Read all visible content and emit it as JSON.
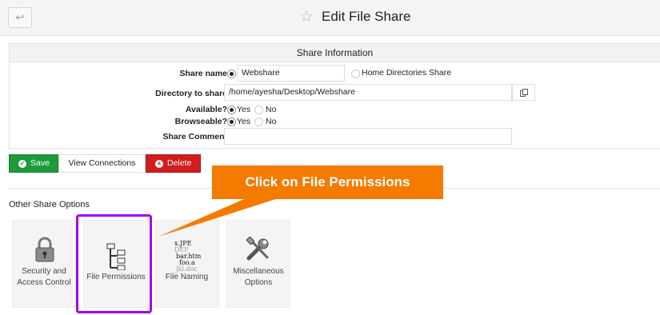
{
  "header": {
    "back_icon": "↩",
    "title": "Edit File Share"
  },
  "panel": {
    "title": "Share Information",
    "share_name_label": "Share name",
    "share_name_value": "Webshare",
    "home_dirs_label": "Home Directories Share",
    "directory_label": "Directory to share",
    "directory_value": "/home/ayesha/Desktop/Webshare",
    "available_label": "Available?",
    "browseable_label": "Browseable?",
    "yes": "Yes",
    "no": "No",
    "comment_label": "Share Comment",
    "comment_value": ""
  },
  "buttons": {
    "save": "Save",
    "view_connections": "View Connections",
    "delete": "Delete"
  },
  "other_options": {
    "title": "Other Share Options",
    "items": [
      {
        "label_line1": "Security and",
        "label_line2": "Access Control",
        "icon": "lock-icon"
      },
      {
        "label_line1": "File Permissions",
        "label_line2": "",
        "icon": "file-tree-icon"
      },
      {
        "label_line1": "File Naming",
        "label_line2": "",
        "icon": "file-naming-icon"
      },
      {
        "label_line1": "Miscellaneous",
        "label_line2": "Options",
        "icon": "tools-icon"
      }
    ]
  },
  "annotation": {
    "callout": "Click on File Permissions",
    "accent": "#f57a00",
    "highlight": "#a300e6"
  },
  "icon_text": {
    "naming_1": "x.JPE",
    "naming_2": "DEF",
    "naming_3": "bar.htm",
    "naming_4": "foo.a",
    "naming_5": "jkl.doc"
  }
}
